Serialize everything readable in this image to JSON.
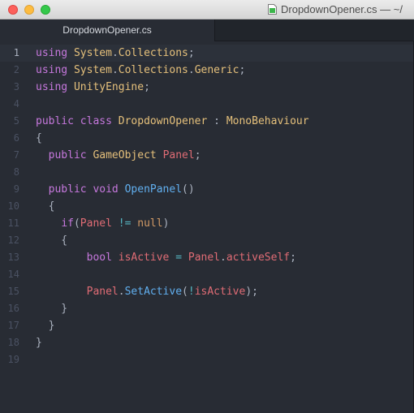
{
  "window": {
    "title": "DropdownOpener.cs — ~/",
    "icon": "csharp-file-icon"
  },
  "tabs": [
    {
      "label": "DropdownOpener.cs",
      "active": true
    }
  ],
  "editor": {
    "cursor_line": 1,
    "line_numbers": [
      "1",
      "2",
      "3",
      "4",
      "5",
      "6",
      "7",
      "8",
      "9",
      "10",
      "11",
      "12",
      "13",
      "14",
      "15",
      "16",
      "17",
      "18",
      "19"
    ],
    "lines": [
      [
        [
          "kw",
          "using"
        ],
        [
          "pu",
          " "
        ],
        [
          "ty",
          "System"
        ],
        [
          "pu",
          "."
        ],
        [
          "ty",
          "Collections"
        ],
        [
          "pu",
          ";"
        ]
      ],
      [
        [
          "kw",
          "using"
        ],
        [
          "pu",
          " "
        ],
        [
          "ty",
          "System"
        ],
        [
          "pu",
          "."
        ],
        [
          "ty",
          "Collections"
        ],
        [
          "pu",
          "."
        ],
        [
          "ty",
          "Generic"
        ],
        [
          "pu",
          ";"
        ]
      ],
      [
        [
          "kw",
          "using"
        ],
        [
          "pu",
          " "
        ],
        [
          "ty",
          "UnityEngine"
        ],
        [
          "pu",
          ";"
        ]
      ],
      [],
      [
        [
          "kw",
          "public"
        ],
        [
          "pu",
          " "
        ],
        [
          "kw",
          "class"
        ],
        [
          "pu",
          " "
        ],
        [
          "ty",
          "DropdownOpener"
        ],
        [
          "pu",
          " : "
        ],
        [
          "ty",
          "MonoBehaviour"
        ]
      ],
      [
        [
          "pu",
          "{"
        ]
      ],
      [
        [
          "pu",
          "  "
        ],
        [
          "kw",
          "public"
        ],
        [
          "pu",
          " "
        ],
        [
          "ty",
          "GameObject"
        ],
        [
          "pu",
          " "
        ],
        [
          "vr",
          "Panel"
        ],
        [
          "pu",
          ";"
        ]
      ],
      [],
      [
        [
          "pu",
          "  "
        ],
        [
          "kw",
          "public"
        ],
        [
          "pu",
          " "
        ],
        [
          "kw",
          "void"
        ],
        [
          "pu",
          " "
        ],
        [
          "fn",
          "OpenPanel"
        ],
        [
          "pu",
          "()"
        ]
      ],
      [
        [
          "pu",
          "  {"
        ]
      ],
      [
        [
          "pu",
          "    "
        ],
        [
          "kw",
          "if"
        ],
        [
          "pu",
          "("
        ],
        [
          "vr",
          "Panel"
        ],
        [
          "pu",
          " "
        ],
        [
          "op",
          "!="
        ],
        [
          "pu",
          " "
        ],
        [
          "cu",
          "null"
        ],
        [
          "pu",
          ")"
        ]
      ],
      [
        [
          "pu",
          "    {"
        ]
      ],
      [
        [
          "pu",
          "        "
        ],
        [
          "kw",
          "bool"
        ],
        [
          "pu",
          " "
        ],
        [
          "vr",
          "isActive"
        ],
        [
          "pu",
          " "
        ],
        [
          "op",
          "="
        ],
        [
          "pu",
          " "
        ],
        [
          "vr",
          "Panel"
        ],
        [
          "pu",
          "."
        ],
        [
          "vr",
          "activeSelf"
        ],
        [
          "pu",
          ";"
        ]
      ],
      [],
      [
        [
          "pu",
          "        "
        ],
        [
          "vr",
          "Panel"
        ],
        [
          "pu",
          "."
        ],
        [
          "fn",
          "SetActive"
        ],
        [
          "pu",
          "("
        ],
        [
          "op",
          "!"
        ],
        [
          "vr",
          "isActive"
        ],
        [
          "pu",
          ");"
        ]
      ],
      [
        [
          "pu",
          "    }"
        ]
      ],
      [
        [
          "pu",
          "  }"
        ]
      ],
      [
        [
          "pu",
          "}"
        ]
      ],
      []
    ]
  }
}
